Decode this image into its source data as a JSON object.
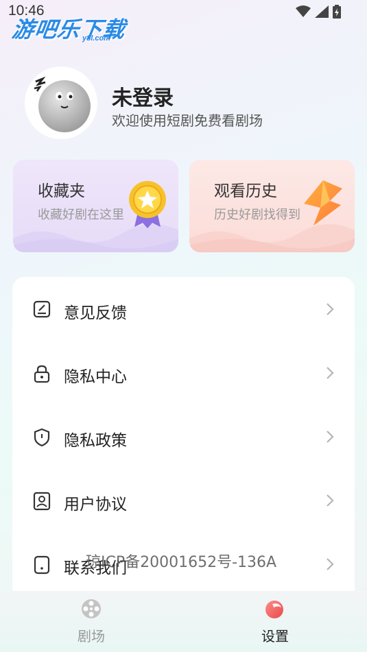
{
  "status": {
    "time": "10:46"
  },
  "watermark": {
    "brand": "游吧乐下载",
    "domain": "y8l.com"
  },
  "profile": {
    "name": "未登录",
    "subtitle": "欢迎使用短剧免费看剧场"
  },
  "cards": [
    {
      "title": "收藏夹",
      "subtitle": "收藏好剧在这里",
      "icon": "medal-icon"
    },
    {
      "title": "观看历史",
      "subtitle": "历史好剧找得到",
      "icon": "lightning-icon"
    }
  ],
  "menu": [
    {
      "label": "意见反馈",
      "icon": "edit-icon"
    },
    {
      "label": "隐私中心",
      "icon": "lock-icon"
    },
    {
      "label": "隐私政策",
      "icon": "shield-icon"
    },
    {
      "label": "用户协议",
      "icon": "user-card-icon"
    },
    {
      "label": "联系我们",
      "icon": "phone-icon"
    }
  ],
  "icp": "琼ICP备20001652号-136A",
  "tabs": [
    {
      "label": "剧场",
      "icon": "film-reel-icon",
      "active": false
    },
    {
      "label": "设置",
      "icon": "settings-blob-icon",
      "active": true
    }
  ],
  "colors": {
    "accent": "#f05a5a",
    "inactive": "#999999",
    "brand_blue": "#2a8be6"
  }
}
